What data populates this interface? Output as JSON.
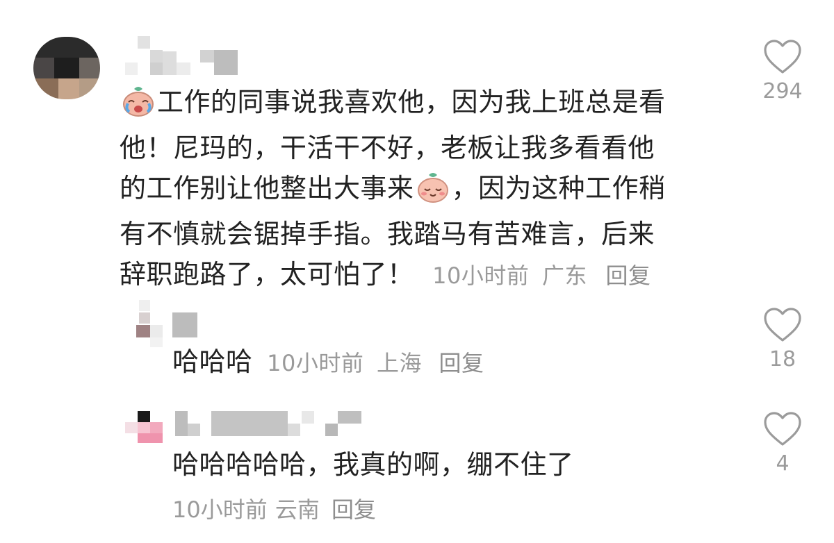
{
  "main_comment": {
    "text_1": "工作的同事说我喜欢他，因为我上班总是看",
    "text_2": "他！尼玛的，干活干不好，老板让我多看看他",
    "text_3a": "的工作别让他整出大事来",
    "text_3b": "，因为这种工作稍",
    "text_4": "有不慎就会锯掉手指。我踏马有苦难言，后来",
    "text_5": "辞职跑路了，太可怕了！",
    "time": "10小时前",
    "location": "广东",
    "reply_label": "回复",
    "like_count": "294"
  },
  "replies": [
    {
      "text": "哈哈哈",
      "time": "10小时前",
      "location": "上海",
      "reply_label": "回复",
      "like_count": "18"
    },
    {
      "text": "哈哈哈哈哈，我真的啊，绷不住了",
      "time": "10小时前",
      "location": "云南",
      "reply_label": "回复",
      "like_count": "4"
    }
  ],
  "icons": {
    "like": "heart-outline-icon",
    "emoji_cry": "crying-peach-emoji",
    "emoji_smile": "smiling-peach-emoji"
  },
  "colors": {
    "text": "#222222",
    "meta": "#9a9a9a",
    "heart": "#9b9b9b"
  }
}
